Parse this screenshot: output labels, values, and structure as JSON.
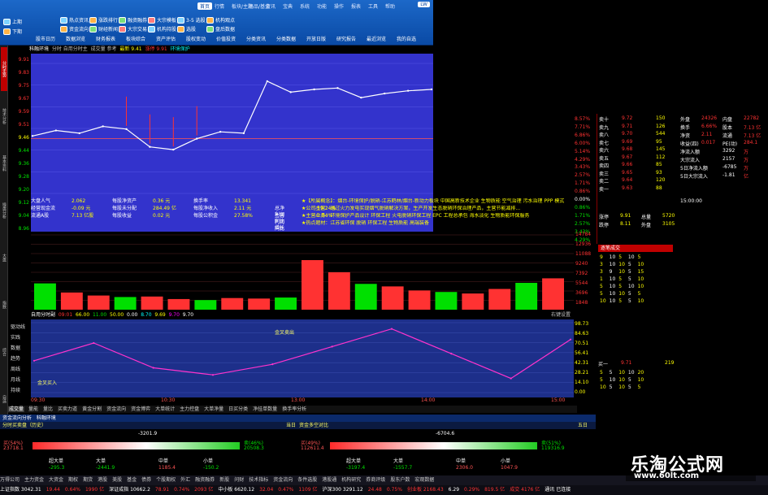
{
  "toolbar": {
    "tabs": [
      "首页",
      "行情",
      "板块/主题",
      "商品/基金",
      "资讯",
      "宝典",
      "系统",
      "功能",
      "操作",
      "报表",
      "工具",
      "帮助"
    ],
    "active_tab": "首页",
    "user": "LW",
    "buttons_row1": [
      "热点资讯",
      "涨跌排行",
      "融资融券",
      "大宗模板",
      "3-5 选股",
      "机构观点"
    ],
    "buttons_row2": [
      "资金流向",
      "财经新闻",
      "大宗交易",
      "机构持股",
      "选股",
      "盘后数据"
    ],
    "buttons_main": [
      "上期",
      "下期",
      "股市日历",
      "数据浏览",
      "财务报表",
      "板块综合",
      "资产评估",
      "股权变动",
      "价值投资",
      "分类资讯",
      "分类数据",
      "开放日版",
      "研究报告",
      "最近浏览",
      "我的自选"
    ]
  },
  "sidebar": {
    "items": [
      "分时走势",
      "技术分析",
      "基本资料",
      "操盘分析",
      "大盘",
      "指数",
      "综合",
      "自选",
      "公式"
    ],
    "active": 0
  },
  "chart_header": {
    "title": "科融环境",
    "mode": "分时 自用分时主",
    "vol": "成交量 参考",
    "latest": "最新 9.41",
    "change": "涨停 9.91",
    "tag": "环境保护"
  },
  "price_axis": {
    "left": [
      "9.91",
      "9.83",
      "9.75",
      "9.67",
      "9.59",
      "9.51",
      "9.46",
      "9.44",
      "9.36",
      "9.28",
      "9.20",
      "9.12",
      "9.04",
      "8.96"
    ],
    "right": [
      "8.57%",
      "7.71%",
      "6.86%",
      "6.00%",
      "5.14%",
      "4.29%",
      "3.43%",
      "2.57%",
      "1.71%",
      "0.86%",
      "0.00%",
      "0.86%",
      "1.71%",
      "2.57%",
      "3.43%",
      "4.29%"
    ]
  },
  "info_left": [
    [
      "大盘人气",
      "2.062",
      "每股净资产",
      "0.36 元",
      "换手率",
      "13.341"
    ],
    [
      "经营现金流",
      "-0.09 元",
      "每股未分配",
      "284.49 亿",
      "每股净收入",
      "2.11 元",
      "总净利润同比增长",
      "-59.24%"
    ],
    [
      "流通A股",
      "7.13 亿股",
      "每股收益",
      "0.02 元",
      "每股公积金",
      "27.58%",
      "主营利润同比增长",
      "-1.94%"
    ]
  ],
  "info_right": [
    "★【所属概念】：烟台-环境保护/脱硝-江苏鹤林/烟台-新动力板块 中国高新技术企业 生物质能 空气治理 污水治理 PPP 模式",
    "★公司主营：通过火力发电实现烟气脱硝解决方案，生产开发生态脱硝环保治理产品，主营节能减排...",
    "★主营业务：环境保护产品设计 环保工程 火电脱硝环保工程 EPC 工程总承包 海水淡化 生物质能环保服务",
    "★热点题材：江苏省环保 脱硝 环保工程 生物质能 高端装备"
  ],
  "volume_axis": [
    "14784",
    "12936",
    "11088",
    "9240",
    "7392",
    "5544",
    "3696",
    "1848"
  ],
  "volume_bar": {
    "title": "自用分时副",
    "a": "09:01",
    "b": "66.00",
    "c": "11.00",
    "d": "50.00",
    "e": "0.00",
    "f": "8.70",
    "g": "9.69",
    "h": "9.70",
    "i": "9.70",
    "btn": "右键设置"
  },
  "indicator": {
    "labels": [
      "驱动线",
      "实践",
      "数据",
      "趋势",
      "周线",
      "月线",
      "持续"
    ],
    "axis": [
      "98.73",
      "84.63",
      "70.51",
      "56.41",
      "42.31",
      "28.21",
      "14.10",
      "0.00"
    ],
    "buy": "金叉买入",
    "sell": "金叉卖出"
  },
  "time_axis": [
    "09:30",
    "10:30",
    "13:00",
    "14:00",
    "15:00"
  ],
  "bottom_tabs": [
    "成交量",
    "量能",
    "量比",
    "买卖力道",
    "黄金分割",
    "资金流向",
    "资金博弈",
    "大单统计",
    "主力控盘",
    "大单净量",
    "日买分类",
    "净挂单数量",
    "换手率分析"
  ],
  "flow": {
    "header": [
      "资金流向分析",
      "科融环境",
      "分时买卖盘（历史）",
      "当日",
      "资金多空对比",
      "五日"
    ],
    "panels": [
      {
        "title": "-3201.9",
        "left_label": "买(54%)",
        "left_val": "23718.1",
        "right_label": "卖(46%)",
        "right_val": "20508.3",
        "big": "超大单",
        "big_val": "-295.3",
        "large": "大单",
        "large_val": "-2441.9",
        "mid": "中单",
        "mid_val": "1185.4",
        "small": "小单",
        "small_val": "-150.2"
      },
      {
        "title": "-6704.6",
        "left_label": "买(49%)",
        "left_val": "112611.4",
        "right_label": "卖(51%)",
        "right_val": "119316.9",
        "big": "超大单",
        "big_val": "-3197.4",
        "large": "大单",
        "large_val": "-1557.7",
        "mid": "中单",
        "mid_val": "2306.0",
        "small": "小单",
        "small_val": "1047.9"
      }
    ]
  },
  "taskbar": [
    "万得公司",
    "主力资金",
    "大资金",
    "期权",
    "期货",
    "港股",
    "美股",
    "基金",
    "债券",
    "个股期权",
    "外汇",
    "融资融券",
    "新股",
    "问财",
    "技术指标",
    "资金流向",
    "条件选股",
    "港股通",
    "机构研究",
    "券商评级",
    "股东户数",
    "宏观数据"
  ],
  "status": [
    "上证指数 3042.31",
    "19.44",
    "0.64%",
    "1990 亿",
    "深证成指 10662.2",
    "78.91",
    "0.74%",
    "2093 亿",
    "中小板 6620.12",
    "32.04",
    "0.47%",
    "1109 亿",
    "沪深300 3291.12",
    "24.48",
    "0.75%",
    "创业板 2168.43",
    "6.29",
    "0.29%",
    "819.5 亿",
    "成交 4176 亿",
    "通讯 已连接"
  ],
  "quote": {
    "asks": [
      [
        "卖十",
        "9.72",
        "150"
      ],
      [
        "卖九",
        "9.71",
        "126"
      ],
      [
        "卖八",
        "9.70",
        "544"
      ],
      [
        "卖七",
        "9.69",
        "95"
      ],
      [
        "卖六",
        "9.68",
        "145"
      ],
      [
        "卖五",
        "9.67",
        "112"
      ],
      [
        "卖四",
        "9.66",
        "85"
      ],
      [
        "卖三",
        "9.65",
        "93"
      ],
      [
        "卖二",
        "9.64",
        "120"
      ],
      [
        "卖一",
        "9.63",
        "88"
      ]
    ],
    "right": [
      [
        "外盘",
        "24326",
        "内盘",
        "22782"
      ],
      [
        "换手",
        "6.66%",
        "股本",
        "7.13 亿"
      ],
      [
        "净资",
        "2.11",
        "流通",
        "7.13 亿"
      ],
      [
        "收益(四)",
        "0.017",
        "PE(动)",
        "284.1"
      ],
      [
        "净流入额",
        "",
        "3292",
        "万"
      ],
      [
        "大宗流入",
        "",
        "2157",
        "万"
      ],
      [
        "5日净流入额",
        "",
        "-6785",
        "万"
      ],
      [
        "5日大宗流入",
        "",
        "-1.81",
        "亿"
      ]
    ],
    "stats": [
      [
        "涨停",
        "9.91",
        "总量",
        "5720"
      ],
      [
        "跌停",
        "8.11",
        "外盘",
        "3105"
      ]
    ]
  },
  "ticks": {
    "time": "15:00:00",
    "title": "逐笔成交",
    "rows": [
      [
        "9",
        "10",
        "5",
        "10",
        "5"
      ],
      [
        "3",
        "10",
        "10",
        "5",
        "10"
      ],
      [
        "3",
        "9",
        "10",
        "5",
        "15"
      ],
      [
        "1",
        "10",
        "5",
        "5",
        "10"
      ],
      [
        "5",
        "10",
        "5",
        "10",
        "10"
      ],
      [
        "5",
        "10",
        "10",
        "5",
        "5"
      ],
      [
        "10",
        "10",
        "5",
        "5",
        "10"
      ]
    ],
    "ask_label": "买一",
    "ask_price": "9.71",
    "ask_vol": "219",
    "bottom": [
      [
        "5",
        "5",
        "10",
        "10",
        "20"
      ],
      [
        "5",
        "10",
        "10",
        "5",
        "10"
      ],
      [
        "10",
        "5",
        "10",
        "5",
        "5"
      ]
    ]
  },
  "watermark": {
    "title": "乐淘公式网",
    "url": "www.60lt.com"
  },
  "colors": {
    "up": "#ff3232",
    "down": "#00e000",
    "chart_bg": "#3333cc",
    "ind_bg": "#1d2f8a",
    "toolbar": "#1c68c8"
  },
  "chart_data": [
    {
      "type": "line",
      "title": "科融环境",
      "xlabel": "",
      "ylabel": "",
      "ylim": [
        8.96,
        9.91
      ],
      "x": [
        "09:30",
        "09:45",
        "10:00",
        "10:15",
        "10:30",
        "10:45",
        "11:00",
        "11:15",
        "11:30",
        "13:00",
        "13:15",
        "13:30",
        "13:45",
        "14:00",
        "14:15",
        "14:30",
        "14:45",
        "15:00"
      ],
      "series": [
        {
          "values": [
            9.38,
            9.42,
            9.4,
            9.45,
            9.43,
            9.3,
            9.28,
            9.36,
            9.41,
            9.4,
            9.78,
            9.7,
            9.72,
            9.73,
            9.66,
            9.69,
            9.71,
            9.72
          ]
        }
      ]
    },
    {
      "type": "bar",
      "title": "成交量",
      "ylim": [
        0,
        14784
      ],
      "values": [
        5200,
        3400,
        2800,
        2500,
        2600,
        2100,
        1900,
        2300,
        2200,
        2400,
        9800,
        7400,
        5100,
        4600,
        3800,
        3500,
        3200,
        4100,
        5300,
        6200
      ]
    },
    {
      "type": "line",
      "title": "自用分时副",
      "ylim": [
        0,
        98.73
      ],
      "x": [
        "09:30",
        "10:00",
        "10:30",
        "11:00",
        "11:30",
        "13:00",
        "13:30",
        "14:00",
        "14:30",
        "15:00"
      ],
      "series": [
        {
          "values": [
            45,
            70,
            35,
            25,
            40,
            65,
            90,
            55,
            20,
            75
          ]
        }
      ]
    }
  ]
}
